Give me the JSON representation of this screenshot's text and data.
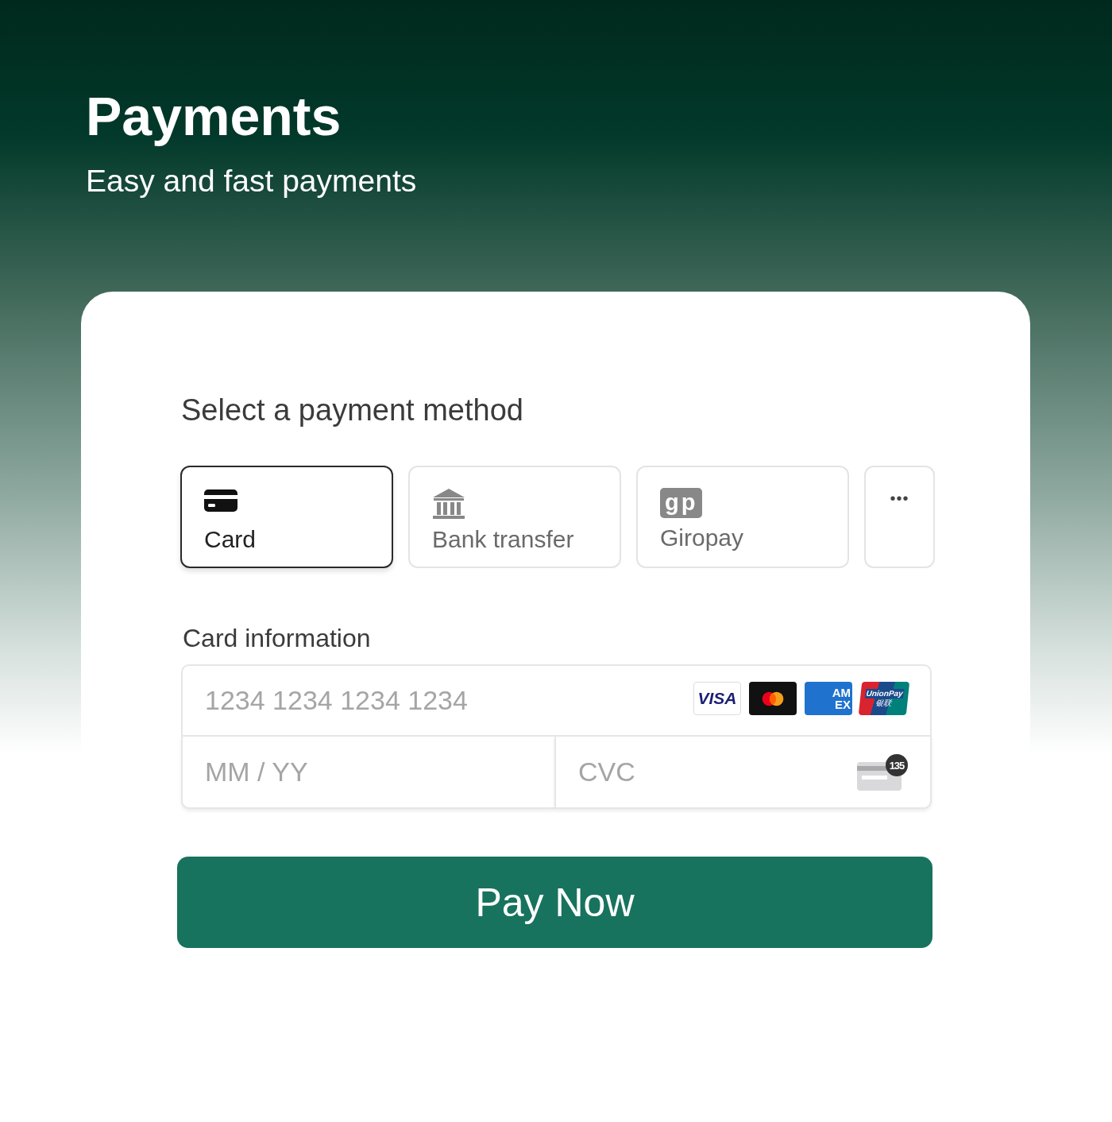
{
  "header": {
    "title": "Payments",
    "subtitle": "Easy and fast payments"
  },
  "payment": {
    "heading": "Select a payment method",
    "methods": [
      {
        "kind": "card",
        "label": "Card",
        "selected": true
      },
      {
        "kind": "bank",
        "label": "Bank transfer",
        "selected": false
      },
      {
        "kind": "giropay",
        "label": "Giropay",
        "icon_text": "gp",
        "selected": false
      },
      {
        "kind": "more",
        "label": "•••",
        "selected": false
      }
    ],
    "card_info": {
      "label": "Card information",
      "number": {
        "placeholder": "1234 1234 1234 1234"
      },
      "brands": [
        {
          "kind": "visa",
          "label": "VISA"
        },
        {
          "kind": "mastercard"
        },
        {
          "kind": "amex",
          "label": "AM",
          "label_2": "EX"
        },
        {
          "kind": "unionpay",
          "label": "UnionPay",
          "label_2": "银联"
        }
      ],
      "expiry": {
        "placeholder": "MM / YY"
      },
      "cvc": {
        "placeholder": "CVC",
        "badge": "135"
      }
    },
    "button": "Pay Now"
  }
}
